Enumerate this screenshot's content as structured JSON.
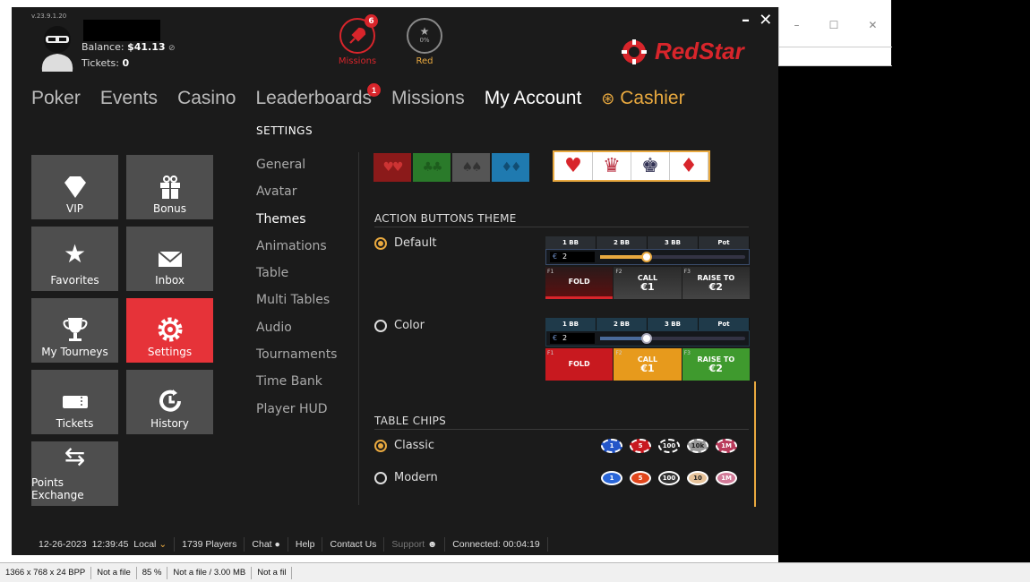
{
  "app": {
    "version": "v.23.9.1.20",
    "balance_label": "Balance:",
    "balance_value": "$41.13",
    "tickets_label": "Tickets:",
    "tickets_value": "0",
    "logo_text": "RedStar",
    "window_controls": "– ✕"
  },
  "top_icons": {
    "missions": {
      "label": "Missions",
      "badge": "6"
    },
    "red": {
      "label": "Red",
      "progress_text": "0%"
    }
  },
  "main_nav": {
    "items": [
      "Poker",
      "Events",
      "Casino",
      "Leaderboards",
      "Missions",
      "My Account",
      "Cashier"
    ],
    "leaderboards_badge": "1"
  },
  "tiles": [
    "VIP",
    "Bonus",
    "Favorites",
    "Inbox",
    "My Tourneys",
    "Settings",
    "Tickets",
    "History",
    "Points Exchange"
  ],
  "settings": {
    "heading": "SETTINGS",
    "items": [
      "General",
      "Avatar",
      "Themes",
      "Animations",
      "Table",
      "Multi Tables",
      "Audio",
      "Tournaments",
      "Time Bank",
      "Player HUD"
    ]
  },
  "themes": {
    "action_buttons_title": "ACTION BUTTONS THEME",
    "option_default": "Default",
    "option_color": "Color",
    "bet_presets": [
      "1 BB",
      "2 BB",
      "3 BB",
      "Pot"
    ],
    "bet_amount": "2",
    "currency": "€",
    "fold": "FOLD",
    "call": "CALL",
    "call_amount": "€1",
    "raise": "RAISE TO",
    "raise_amount": "€2",
    "fkeys": [
      "F1",
      "F2",
      "F3"
    ],
    "slider_level": 0.32,
    "table_chips_title": "TABLE CHIPS",
    "chips_classic": "Classic",
    "chips_modern": "Modern",
    "chip_values": [
      "1",
      "5",
      "100",
      "10k",
      "1M"
    ],
    "chip_values_modern": [
      "1",
      "5",
      "100",
      "10",
      "1M"
    ],
    "colors": {
      "accent": "#e9a93f",
      "brand": "#d8252b"
    }
  },
  "footer": {
    "date": "12-26-2023",
    "time": "12:39:45",
    "timezone": "Local",
    "players": "1739 Players",
    "chat": "Chat",
    "help": "Help",
    "contact": "Contact Us",
    "support": "Support",
    "connected": "Connected: 00:04:19"
  },
  "viewer_status": [
    "1366 x 768 x 24 BPP",
    "Not a file",
    "85 %",
    "Not a file / 3.00 MB",
    "Not a fil"
  ],
  "host_window_controls": [
    "–",
    "☐",
    "✕"
  ]
}
